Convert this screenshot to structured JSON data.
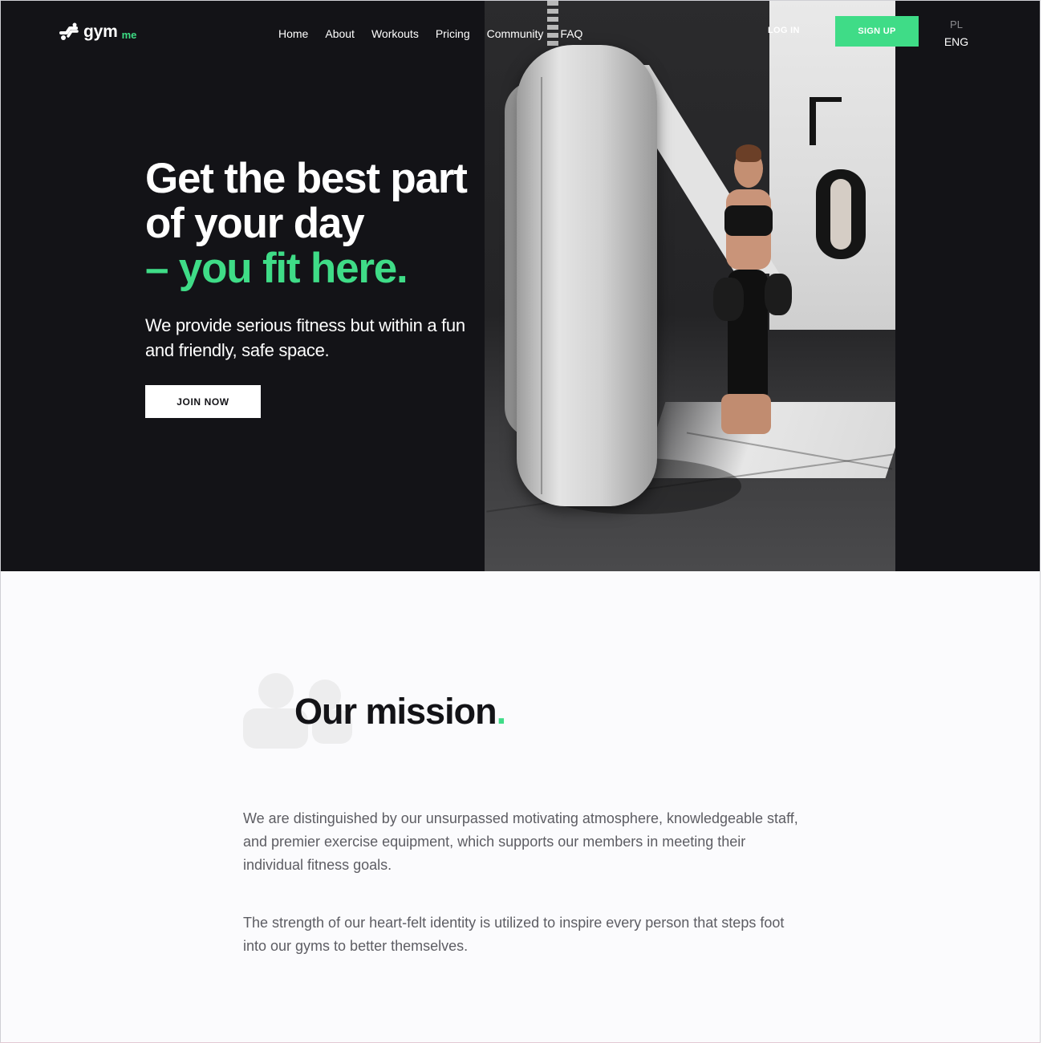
{
  "brand": {
    "name": "gym",
    "suffix": "me",
    "accent": "#3fdc87",
    "dark": "#131317"
  },
  "nav": {
    "items": [
      {
        "label": "Home"
      },
      {
        "label": "About"
      },
      {
        "label": "Workouts"
      },
      {
        "label": "Pricing"
      },
      {
        "label": "Community"
      },
      {
        "label": "FAQ"
      }
    ],
    "login_label": "LOG IN",
    "signup_label": "SIGN UP",
    "languages": [
      "PL",
      "ENG"
    ],
    "active_language": "ENG"
  },
  "hero": {
    "headline_line1": "Get the best part",
    "headline_line2": "of your day",
    "headline_line3": "– you fit here.",
    "subtext": "We provide serious fitness but within a fun and friendly, safe space.",
    "cta_label": "JOIN NOW",
    "image": "woman-boxing-near-punching-bag"
  },
  "mission": {
    "title": "Our mission",
    "title_dot": ".",
    "icon": "users-icon",
    "paragraphs": [
      "We are distinguished by our unsurpassed motivating atmosphere, knowledgeable staff, and premier exercise equipment, which supports our members in meeting their individual fitness goals.",
      "The strength of our heart-felt identity is utilized to inspire every person that steps foot into our gyms to better themselves."
    ]
  }
}
